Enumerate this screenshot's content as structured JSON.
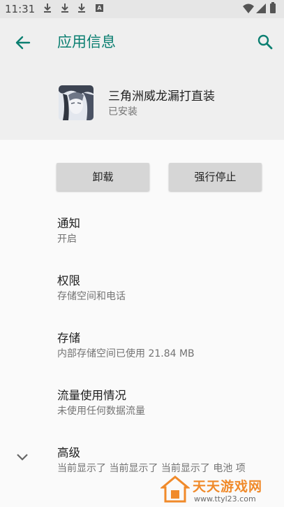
{
  "status_bar": {
    "time": "11:31",
    "icons": [
      "download-icon",
      "download-icon",
      "download-icon",
      "a-icon",
      "wifi-icon",
      "signal-icon",
      "battery-icon"
    ],
    "a_label": "A"
  },
  "toolbar": {
    "title": "应用信息",
    "accent_color": "#0b7f71"
  },
  "app": {
    "name": "三角洲威龙漏打直装",
    "status": "已安装"
  },
  "actions": {
    "uninstall_label": "卸载",
    "force_stop_label": "强行停止"
  },
  "settings": [
    {
      "title": "通知",
      "subtitle": "开启"
    },
    {
      "title": "权限",
      "subtitle": "存储空间和电话"
    },
    {
      "title": "存储",
      "subtitle": "内部存储空间已使用 21.84 MB"
    },
    {
      "title": "流量使用情况",
      "subtitle": "未使用任何数据流量"
    },
    {
      "title": "高级",
      "subtitle": "当前显示了 当前显示了 当前显示了 电池 项"
    }
  ],
  "watermark": {
    "text": "天天游戏网",
    "url": "www.ttyl23.com"
  }
}
